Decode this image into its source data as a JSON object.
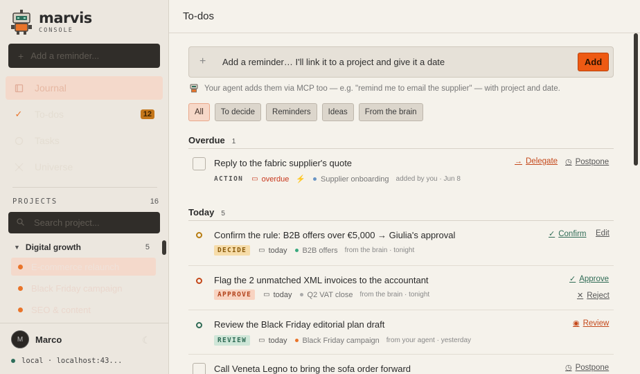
{
  "brand": {
    "name": "marvis",
    "subtitle": "CONSOLE"
  },
  "sidebar": {
    "add_reminder_placeholder": "Add a reminder...",
    "nav": [
      {
        "label": "Journal",
        "icon": "book-icon"
      },
      {
        "label": "To-dos",
        "icon": "check-icon",
        "badge": "12"
      },
      {
        "label": "Tasks",
        "icon": "tasks-icon"
      },
      {
        "label": "Universe",
        "icon": "universe-icon"
      }
    ],
    "projects_label": "PROJECTS",
    "projects_count": "16",
    "search_placeholder": "Search project...",
    "group": {
      "label": "Digital growth",
      "count": "5"
    },
    "projects": [
      "E-commerce relaunch",
      "Black Friday campaign",
      "SEO & content"
    ]
  },
  "user": {
    "initial": "M",
    "name": "Marco",
    "host": "local · localhost:43..."
  },
  "main": {
    "title": "To-dos",
    "composer": {
      "placeholder": "Add a reminder… I'll link it to a project and give it a date",
      "add_label": "Add"
    },
    "hint": "Your agent adds them via MCP too — e.g. \"remind me to email the supplier\" — with project and date.",
    "filters": [
      "All",
      "To decide",
      "Reminders",
      "Ideas",
      "From the brain"
    ],
    "sections": {
      "overdue": {
        "label": "Overdue",
        "count": "1"
      },
      "today": {
        "label": "Today",
        "count": "5"
      }
    },
    "items": [
      {
        "title": "Reply to the fabric supplier's quote",
        "tag": "ACTION",
        "date": "overdue",
        "project": "Supplier onboarding",
        "source": "added by you · Jun 8",
        "actions": [
          "Delegate",
          "Postpone"
        ]
      },
      {
        "title": "Confirm the rule: B2B offers over €5,000 → Giulia's approval",
        "tag": "DECIDE",
        "date": "today",
        "project": "B2B offers",
        "source": "from the brain · tonight",
        "actions": [
          "Confirm",
          "Edit"
        ]
      },
      {
        "title": "Flag the 2 unmatched XML invoices to the accountant",
        "tag": "APPROVE",
        "date": "today",
        "project": "Q2 VAT close",
        "source": "from the brain · tonight",
        "actions": [
          "Approve",
          "Reject"
        ]
      },
      {
        "title": "Review the Black Friday editorial plan draft",
        "tag": "REVIEW",
        "date": "today",
        "project": "Black Friday campaign",
        "source": "from your agent · yesterday",
        "actions": [
          "Review"
        ]
      },
      {
        "title": "Call Veneta Legno to bring the sofa order forward",
        "actions": [
          "Postpone"
        ]
      }
    ]
  },
  "colors": {
    "accent": "#ee5a13",
    "overdue": "#c7361b",
    "decide": "#b77d12",
    "approve": "#c4481a",
    "review": "#2f6b55",
    "action_green": "#2f6b55",
    "action_orange": "#c4481a"
  }
}
